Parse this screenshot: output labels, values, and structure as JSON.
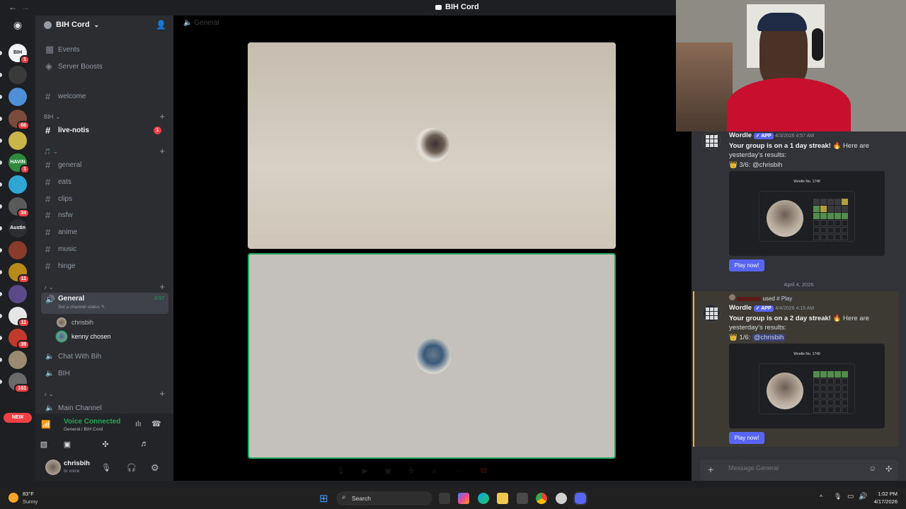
{
  "titlebar": {
    "app_title": "BIH Cord"
  },
  "server_rail": {
    "new_label": "NEW",
    "servers": [
      {
        "label": "BIH",
        "badge": "1",
        "color": "#f2f3f5"
      },
      {
        "label": "",
        "badge": "",
        "color": "#3a3a3a"
      },
      {
        "label": "",
        "badge": "",
        "color": "#4f8fd6"
      },
      {
        "label": "",
        "badge": "66",
        "color": "#7a4b3a"
      },
      {
        "label": "",
        "badge": "",
        "color": "#c9b54a"
      },
      {
        "label": "HAVIN",
        "badge": "1",
        "color": "#2d8a3e"
      },
      {
        "label": "",
        "badge": "",
        "color": "#2fa7d6"
      },
      {
        "label": "",
        "badge": "34",
        "color": "#5a5a5a"
      },
      {
        "label": "Austin",
        "badge": "",
        "color": "#2b2d31"
      },
      {
        "label": "",
        "badge": "",
        "color": "#8a3b2a"
      },
      {
        "label": "",
        "badge": "11",
        "color": "#b78a1a"
      },
      {
        "label": "",
        "badge": "",
        "color": "#5a4a8a"
      },
      {
        "label": "",
        "badge": "11",
        "color": "#e6e6e6"
      },
      {
        "label": "",
        "badge": "39",
        "color": "#c0392b"
      },
      {
        "label": "",
        "badge": "",
        "color": "#9a8a70"
      },
      {
        "label": "",
        "badge": "161",
        "color": "#6a6a6a"
      }
    ]
  },
  "sidebar": {
    "server_name": "BIH Cord",
    "top_items": [
      {
        "label": "Events"
      },
      {
        "label": "Server Boosts"
      }
    ],
    "welcome": "welcome",
    "cat_bih": "BIH",
    "live_notis": "live-notis",
    "live_notis_badge": "1",
    "cat_two": "🎵",
    "text_channels": [
      "general",
      "eats",
      "clips",
      "nsfw",
      "anime",
      "music",
      "hinge"
    ],
    "cat_three": "♪",
    "voice_general": "General",
    "voice_timer": "0:57",
    "voice_status": "Set a channel status",
    "voice_users": [
      "chrisbih",
      "kenny chosen"
    ],
    "voice_channels": [
      "Chat With Bih",
      "BIH"
    ],
    "cat_four": "♪",
    "main_channel": "Main Channel"
  },
  "voice_panel": {
    "status": "Voice Connected",
    "location": "General / BIH Cord"
  },
  "user_panel": {
    "username": "chrisbih",
    "status": "In voice"
  },
  "stage": {
    "channel": "General"
  },
  "chat": {
    "messages": [
      {
        "author": "Wordle",
        "app_tag": "✓ APP",
        "timestamp": "4/3/2026 4:57 AM",
        "line1_bold": "Your group is on a 1 day streak!",
        "line1_rest": " 🔥 Here are",
        "line2": "yesterday's results:",
        "result": "👑 3/6: @chrisbih",
        "card_title": "Wordle No. 1748",
        "play_label": "Play now!"
      },
      {
        "author": "Wordle",
        "app_tag": "✓ APP",
        "timestamp": "4/4/2026 4:15 AM",
        "line1_bold": "Your group is on a 2 day streak!",
        "line1_rest": " 🔥 Here are",
        "line2": "yesterday's results:",
        "result_prefix": "👑 1/6: ",
        "result_mention": "@chrisbih",
        "card_title": "Wordle No. 1749",
        "play_label": "Play now!"
      }
    ],
    "date_divider": "April 4, 2026",
    "used_text": "used",
    "used_command": "Play",
    "input_placeholder": "Message General"
  },
  "taskbar": {
    "weather_temp": "83°F",
    "weather_desc": "Sunny",
    "search_label": "Search",
    "time": "1:02 PM",
    "date": "4/17/2026"
  },
  "colors": {
    "accent": "#5865f2",
    "voice_green": "#23a55a",
    "mention": "#c9cdfb"
  }
}
